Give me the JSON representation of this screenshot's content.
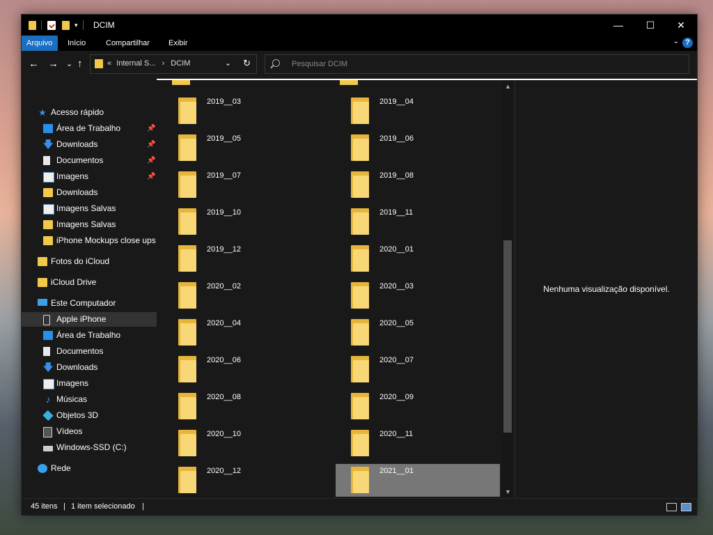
{
  "window": {
    "title": "DCIM",
    "controls": {
      "minimize": "—",
      "maximize": "☐",
      "close": "✕"
    }
  },
  "ribbon": {
    "tabs": [
      "Arquivo",
      "Início",
      "Compartilhar",
      "Exibir"
    ],
    "help": "?",
    "collapse": "⌄"
  },
  "nav": {
    "back": "←",
    "forward": "→",
    "recent": "⌄",
    "up": "↑",
    "breadcrumb_prefix": "«",
    "breadcrumb": [
      "Internal S...",
      "DCIM"
    ],
    "breadcrumb_sep": "›",
    "dropdown": "⌄",
    "refresh": "↻",
    "search_placeholder": "Pesquisar DCIM"
  },
  "sidebar": {
    "items": [
      {
        "label": "Acesso rápido",
        "icon": "star-icon",
        "indent": 0,
        "pinned": false
      },
      {
        "label": "Área de Trabalho",
        "icon": "desktop-icon",
        "indent": 1,
        "pinned": true
      },
      {
        "label": "Downloads",
        "icon": "download-icon",
        "indent": 1,
        "pinned": true
      },
      {
        "label": "Documentos",
        "icon": "document-icon",
        "indent": 1,
        "pinned": true
      },
      {
        "label": "Imagens",
        "icon": "image-icon",
        "indent": 1,
        "pinned": true
      },
      {
        "label": "Downloads",
        "icon": "folder-icon",
        "indent": 1,
        "pinned": false
      },
      {
        "label": "Imagens Salvas",
        "icon": "laptop-icon",
        "indent": 1,
        "pinned": false
      },
      {
        "label": "Imagens Salvas",
        "icon": "folder-icon",
        "indent": 1,
        "pinned": false
      },
      {
        "label": "iPhone Mockups close ups",
        "icon": "folder-icon",
        "indent": 1,
        "pinned": false
      },
      {
        "label": "Fotos do iCloud",
        "icon": "folder-icon",
        "indent": 0,
        "pinned": false
      },
      {
        "label": "iCloud Drive",
        "icon": "folder-icon",
        "indent": 0,
        "pinned": false
      },
      {
        "label": "Este Computador",
        "icon": "computer-icon",
        "indent": 0,
        "pinned": false
      },
      {
        "label": "Apple iPhone",
        "icon": "phone-icon",
        "indent": 1,
        "pinned": false,
        "selected": true
      },
      {
        "label": "Área de Trabalho",
        "icon": "desktop-icon",
        "indent": 1,
        "pinned": false
      },
      {
        "label": "Documentos",
        "icon": "document-icon",
        "indent": 1,
        "pinned": false
      },
      {
        "label": "Downloads",
        "icon": "download-icon",
        "indent": 1,
        "pinned": false
      },
      {
        "label": "Imagens",
        "icon": "image-icon",
        "indent": 1,
        "pinned": false
      },
      {
        "label": "Músicas",
        "icon": "music-icon",
        "indent": 1,
        "pinned": false
      },
      {
        "label": "Objetos 3D",
        "icon": "cube-icon",
        "indent": 1,
        "pinned": false
      },
      {
        "label": "Vídeos",
        "icon": "video-icon",
        "indent": 1,
        "pinned": false
      },
      {
        "label": "Windows-SSD (C:)",
        "icon": "drive-icon",
        "indent": 1,
        "pinned": false
      },
      {
        "label": "Rede",
        "icon": "network-icon",
        "indent": 0,
        "pinned": false
      }
    ],
    "pin_glyph": "📌"
  },
  "folders": [
    "2019__03",
    "2019__04",
    "2019__05",
    "2019__06",
    "2019__07",
    "2019__08",
    "2019__10",
    "2019__11",
    "2019__12",
    "2020__01",
    "2020__02",
    "2020__03",
    "2020__04",
    "2020__05",
    "2020__06",
    "2020__07",
    "2020__08",
    "2020__09",
    "2020__10",
    "2020__11",
    "2020__12",
    "2021__01"
  ],
  "selected_folder": "2021__01",
  "preview": {
    "message": "Nenhuma visualização disponível."
  },
  "status": {
    "count": "45 itens",
    "selection": "1 item selecionado",
    "sep": "|"
  },
  "colors": {
    "accent": "#1a6fc1",
    "folder": "#f2c84b",
    "background": "#191919"
  }
}
